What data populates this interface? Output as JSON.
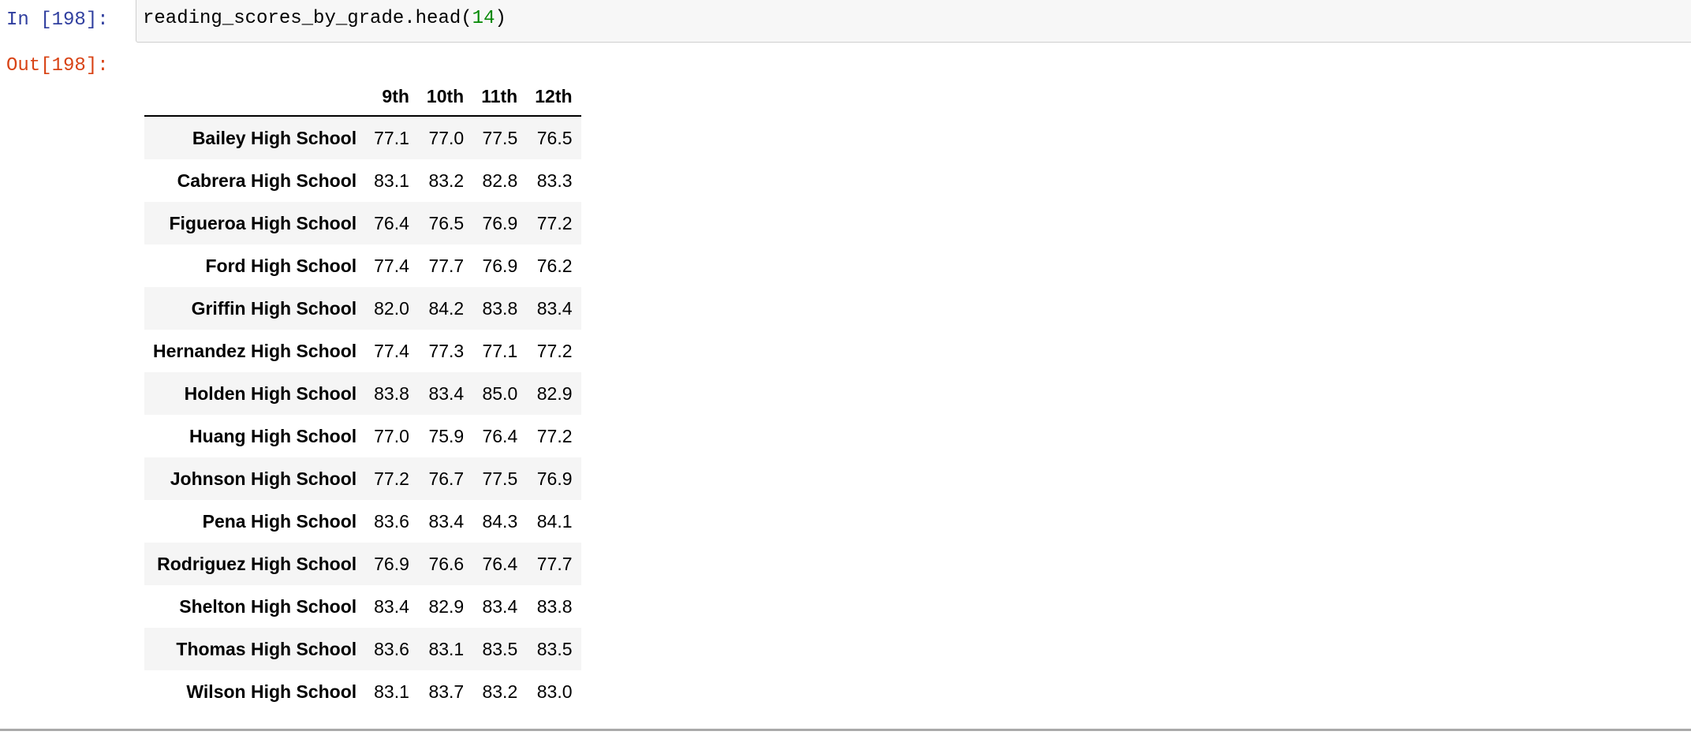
{
  "cell": {
    "input_prompt": "In [198]:",
    "output_prompt": "Out[198]:",
    "code_prefix": "reading_scores_by_grade.head(",
    "code_arg": "14",
    "code_suffix": ")"
  },
  "table": {
    "index_header": "",
    "columns": [
      "9th",
      "10th",
      "11th",
      "12th"
    ],
    "rows": [
      {
        "name": "Bailey High School",
        "values": [
          "77.1",
          "77.0",
          "77.5",
          "76.5"
        ]
      },
      {
        "name": "Cabrera High School",
        "values": [
          "83.1",
          "83.2",
          "82.8",
          "83.3"
        ]
      },
      {
        "name": "Figueroa High School",
        "values": [
          "76.4",
          "76.5",
          "76.9",
          "77.2"
        ]
      },
      {
        "name": "Ford High School",
        "values": [
          "77.4",
          "77.7",
          "76.9",
          "76.2"
        ]
      },
      {
        "name": "Griffin High School",
        "values": [
          "82.0",
          "84.2",
          "83.8",
          "83.4"
        ]
      },
      {
        "name": "Hernandez High School",
        "values": [
          "77.4",
          "77.3",
          "77.1",
          "77.2"
        ]
      },
      {
        "name": "Holden High School",
        "values": [
          "83.8",
          "83.4",
          "85.0",
          "82.9"
        ]
      },
      {
        "name": "Huang High School",
        "values": [
          "77.0",
          "75.9",
          "76.4",
          "77.2"
        ]
      },
      {
        "name": "Johnson High School",
        "values": [
          "77.2",
          "76.7",
          "77.5",
          "76.9"
        ]
      },
      {
        "name": "Pena High School",
        "values": [
          "83.6",
          "83.4",
          "84.3",
          "84.1"
        ]
      },
      {
        "name": "Rodriguez High School",
        "values": [
          "76.9",
          "76.6",
          "76.4",
          "77.7"
        ]
      },
      {
        "name": "Shelton High School",
        "values": [
          "83.4",
          "82.9",
          "83.4",
          "83.8"
        ]
      },
      {
        "name": "Thomas High School",
        "values": [
          "83.6",
          "83.1",
          "83.5",
          "83.5"
        ]
      },
      {
        "name": "Wilson High School",
        "values": [
          "83.1",
          "83.7",
          "83.2",
          "83.0"
        ]
      }
    ]
  }
}
